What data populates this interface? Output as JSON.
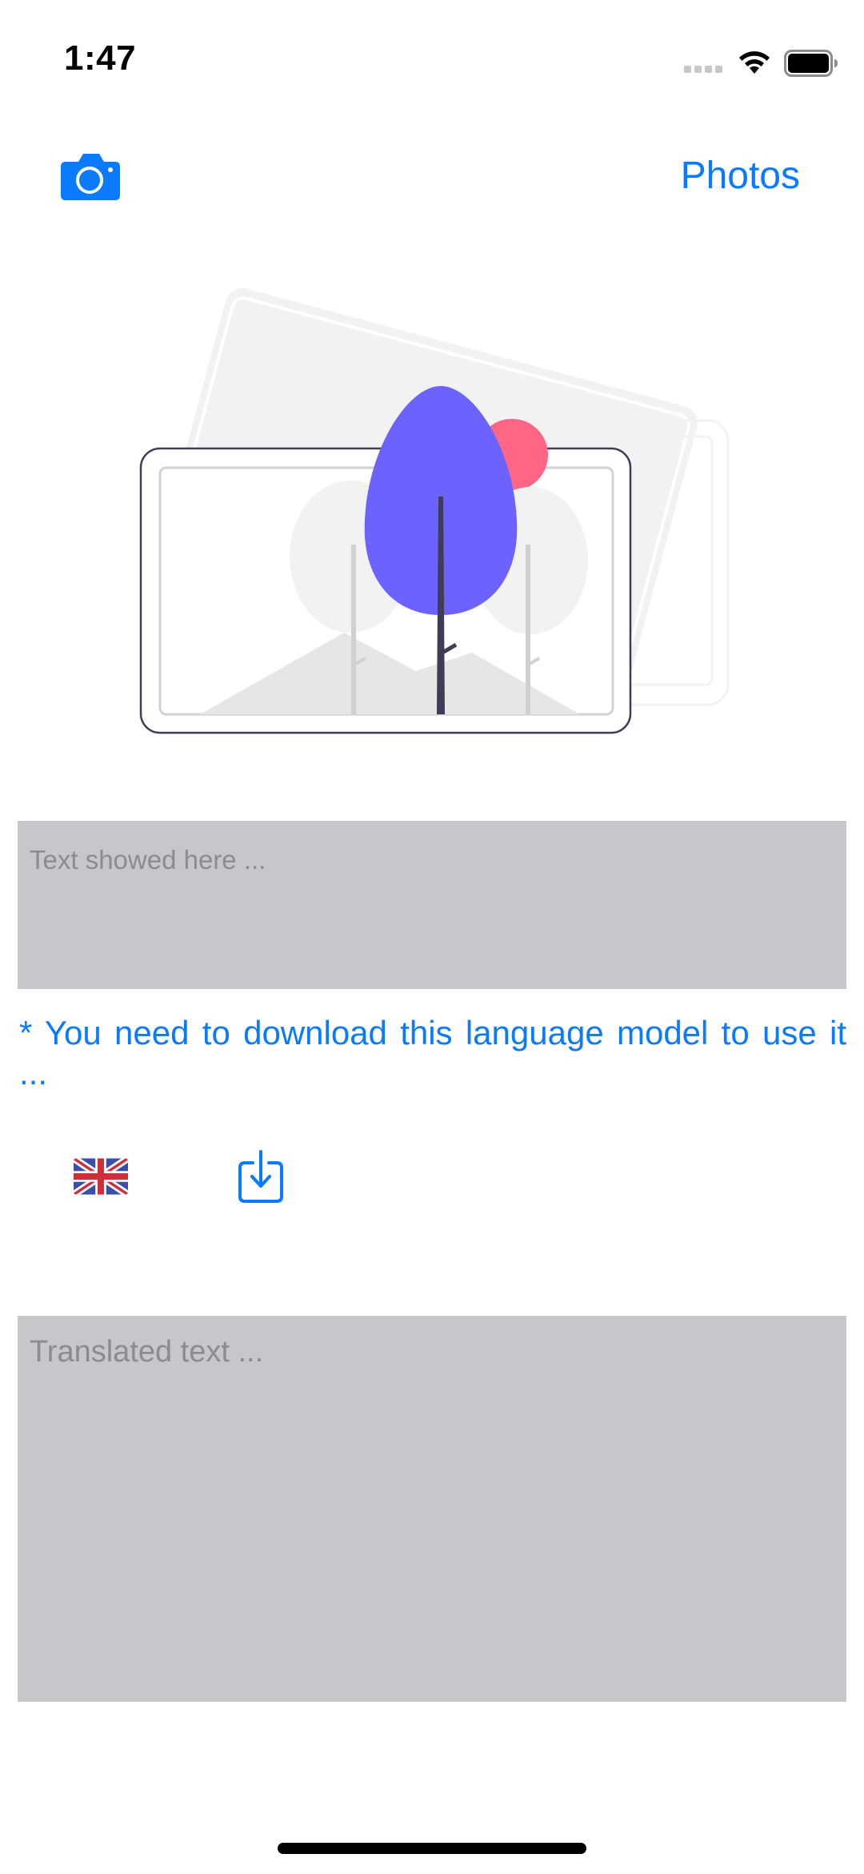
{
  "status_bar": {
    "time": "1:47"
  },
  "nav": {
    "camera_icon": "camera-icon",
    "photos_label": "Photos",
    "accent_color": "#0a7aff"
  },
  "ocr": {
    "placeholder": "Text showed here ..."
  },
  "notice": {
    "text": "* You need to download this language model to use it ..."
  },
  "language": {
    "flag_icon": "uk-flag-icon",
    "download_icon": "download-icon"
  },
  "translation": {
    "placeholder": "Translated text ..."
  },
  "colors": {
    "textbox_background": "#c7c6cb",
    "placeholder_text": "#8c8c90",
    "illustration_tree": "#6c63ff",
    "illustration_sun": "#ff6584"
  }
}
